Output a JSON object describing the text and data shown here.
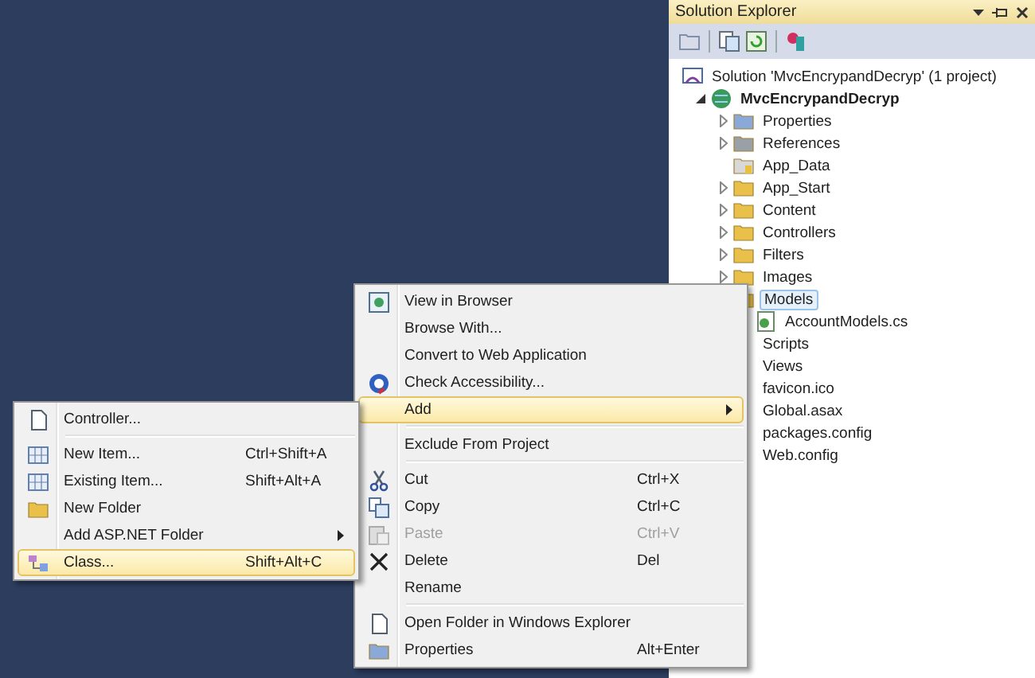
{
  "solution_explorer": {
    "title": "Solution Explorer",
    "tree": [
      {
        "label": "Solution 'MvcEncrypandDecryp' (1 project)",
        "kind": "solution",
        "children": [
          {
            "label": "MvcEncrypandDecryp",
            "kind": "project",
            "expanded": true,
            "children": [
              {
                "label": "Properties",
                "kind": "properties",
                "expanded": false
              },
              {
                "label": "References",
                "kind": "references",
                "expanded": false
              },
              {
                "label": "App_Data",
                "kind": "data-folder"
              },
              {
                "label": "App_Start",
                "kind": "folder",
                "expanded": false
              },
              {
                "label": "Content",
                "kind": "folder",
                "expanded": false
              },
              {
                "label": "Controllers",
                "kind": "folder",
                "expanded": false
              },
              {
                "label": "Filters",
                "kind": "folder",
                "expanded": false
              },
              {
                "label": "Images",
                "kind": "folder",
                "expanded": false
              },
              {
                "label": "Models",
                "kind": "folder",
                "selected": true,
                "children": [
                  {
                    "label": "AccountModels.cs",
                    "kind": "code-file",
                    "selected": false
                  }
                ]
              },
              {
                "label": "Scripts"
              },
              {
                "label": "Views"
              },
              {
                "label": "favicon.ico"
              },
              {
                "label": "Global.asax"
              },
              {
                "label": "packages.config"
              },
              {
                "label": "Web.config"
              }
            ]
          }
        ]
      }
    ]
  },
  "context_menu": {
    "items": [
      {
        "kind": "browser",
        "label": "View in Browser",
        "selected": false
      },
      {
        "kind": "plain",
        "label": "Browse With...",
        "selected": false
      },
      {
        "kind": "plain",
        "label": "Convert to Web Application",
        "selected": false
      },
      {
        "kind": "accessibility",
        "label": "Check Accessibility...",
        "selected": false
      },
      {
        "kind": "plain",
        "label": "Add",
        "submenu": true,
        "selected": true
      },
      {
        "kind": "separator"
      },
      {
        "kind": "plain",
        "label": "Exclude From Project",
        "selected": false
      },
      {
        "kind": "separator"
      },
      {
        "kind": "cut",
        "label": "Cut",
        "shortcut": "Ctrl+X",
        "selected": false
      },
      {
        "kind": "copy",
        "label": "Copy",
        "shortcut": "Ctrl+C",
        "selected": false
      },
      {
        "kind": "paste",
        "label": "Paste",
        "shortcut": "Ctrl+V",
        "disabled": true,
        "selected": false
      },
      {
        "kind": "delete",
        "label": "Delete",
        "shortcut": "Del",
        "selected": false
      },
      {
        "kind": "plain",
        "label": "Rename",
        "selected": false
      },
      {
        "kind": "separator"
      },
      {
        "kind": "page",
        "label": "Open Folder in Windows Explorer",
        "selected": false
      },
      {
        "kind": "properties",
        "label": "Properties",
        "shortcut": "Alt+Enter",
        "selected": false
      }
    ]
  },
  "add_submenu": {
    "items": [
      {
        "kind": "page",
        "label": "Controller...",
        "selected": false
      },
      {
        "kind": "separator"
      },
      {
        "kind": "grid",
        "label": "New Item...",
        "shortcut": "Ctrl+Shift+A",
        "selected": false
      },
      {
        "kind": "grid",
        "label": "Existing Item...",
        "shortcut": "Shift+Alt+A",
        "selected": false
      },
      {
        "kind": "folder",
        "label": "New Folder",
        "selected": false
      },
      {
        "kind": "plain",
        "label": "Add ASP.NET Folder",
        "submenu": true,
        "selected": false
      },
      {
        "kind": "class",
        "label": "Class...",
        "shortcut": "Shift+Alt+C",
        "selected": true
      }
    ]
  }
}
